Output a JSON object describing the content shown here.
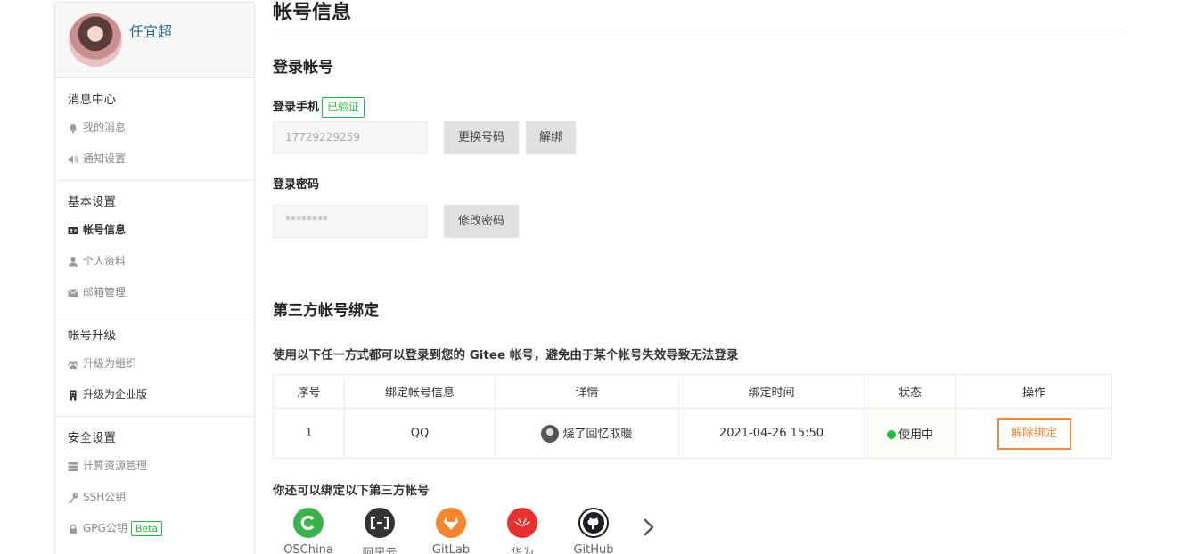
{
  "sidebar": {
    "username": "任宜超",
    "groups": [
      {
        "title": "消息中心",
        "items": [
          {
            "label": "我的消息",
            "icon": "bell-icon"
          },
          {
            "label": "通知设置",
            "icon": "speaker-icon"
          }
        ]
      },
      {
        "title": "基本设置",
        "items": [
          {
            "label": "帐号信息",
            "icon": "id-card-icon",
            "active": true
          },
          {
            "label": "个人资料",
            "icon": "user-icon"
          },
          {
            "label": "邮箱管理",
            "icon": "envelope-icon"
          }
        ]
      },
      {
        "title": "帐号升级",
        "items": [
          {
            "label": "升级为组织",
            "icon": "users-icon"
          },
          {
            "label": "升级为企业版",
            "icon": "building-icon"
          }
        ]
      },
      {
        "title": "安全设置",
        "items": [
          {
            "label": "计算资源管理",
            "icon": "server-icon"
          },
          {
            "label": "SSH公钥",
            "icon": "key-icon"
          },
          {
            "label": "GPG公钥",
            "icon": "lock-icon",
            "badge": "Beta"
          }
        ]
      }
    ]
  },
  "main": {
    "title": "帐号信息",
    "login_section_title": "登录帐号",
    "phone_label": "登录手机",
    "verified_badge": "已验证",
    "phone_value": "17729229259",
    "change_phone_button": "更换号码",
    "unbind_phone_button": "解绑",
    "password_label": "登录密码",
    "password_value": "********",
    "change_password_button": "修改密码",
    "third_party_title": "第三方帐号绑定",
    "third_party_desc": "使用以下任一方式都可以登录到您的 Gitee 帐号，避免由于某个帐号失效导致无法登录",
    "table": {
      "headers": [
        "序号",
        "绑定帐号信息",
        "详情",
        "绑定时间",
        "状态",
        "操作"
      ],
      "rows": [
        {
          "index": "1",
          "account": "QQ",
          "detail": "烧了回忆取暖",
          "time": "2021-04-26 15:50",
          "status": "使用中",
          "action": "解除绑定"
        }
      ]
    },
    "more_title": "你还可以绑定以下第三方帐号",
    "providers": [
      {
        "label": "OSChina",
        "color": "#3bb34a"
      },
      {
        "label": "阿里云",
        "color": "#333333"
      },
      {
        "label": "GitLab",
        "color": "#f5862e"
      },
      {
        "label": "华为",
        "color": "#e8312f"
      },
      {
        "label": "GitHub",
        "color": "#1b1f23"
      }
    ]
  },
  "colors": {
    "accent_green": "#21ba45",
    "danger_orange": "#f0883a",
    "link_blue": "#2e6a8e"
  }
}
